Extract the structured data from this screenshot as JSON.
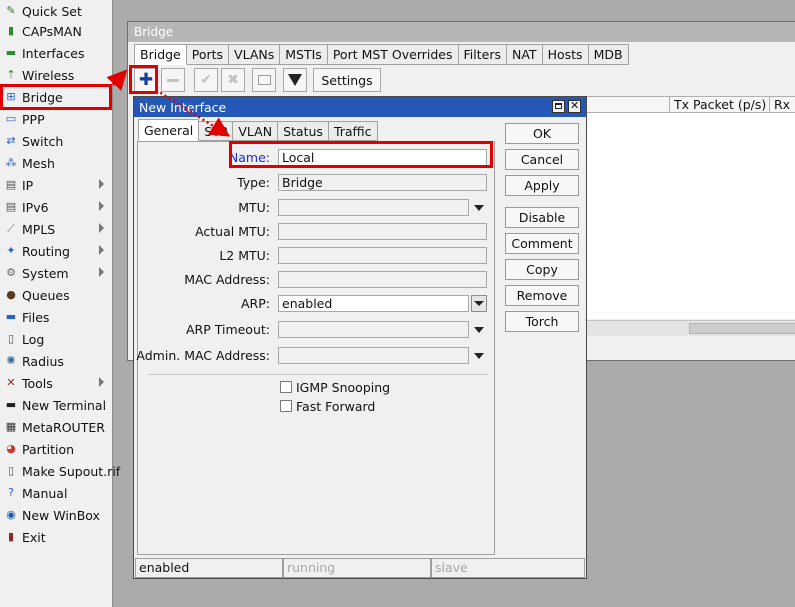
{
  "sidebar": {
    "items": [
      {
        "label": "Quick Set",
        "icon": "quick-set-icon",
        "glyph": "✎",
        "color": "#3b6f2b"
      },
      {
        "label": "CAPsMAN",
        "icon": "capsman-icon",
        "glyph": "▮",
        "color": "#2f8a2f"
      },
      {
        "label": "Interfaces",
        "icon": "interfaces-icon",
        "glyph": "▬",
        "color": "#2f8a2f"
      },
      {
        "label": "Wireless",
        "icon": "wireless-icon",
        "glyph": "⇡",
        "color": "#2f8a2f"
      },
      {
        "label": "Bridge",
        "icon": "bridge-icon",
        "glyph": "⊞",
        "color": "#2a62c8"
      },
      {
        "label": "PPP",
        "icon": "ppp-icon",
        "glyph": "▭",
        "color": "#2a62c8"
      },
      {
        "label": "Switch",
        "icon": "switch-icon",
        "glyph": "⇄",
        "color": "#2a62c8"
      },
      {
        "label": "Mesh",
        "icon": "mesh-icon",
        "glyph": "⁂",
        "color": "#2a62c8"
      },
      {
        "label": "IP",
        "icon": "ip-icon",
        "glyph": "▤",
        "color": "#555555",
        "submenu": true
      },
      {
        "label": "IPv6",
        "icon": "ipv6-icon",
        "glyph": "▤",
        "color": "#555555",
        "submenu": true
      },
      {
        "label": "MPLS",
        "icon": "mpls-icon",
        "glyph": "⟋",
        "color": "#777777",
        "submenu": true
      },
      {
        "label": "Routing",
        "icon": "routing-icon",
        "glyph": "✦",
        "color": "#2a62c8",
        "submenu": true
      },
      {
        "label": "System",
        "icon": "system-icon",
        "glyph": "⚙",
        "color": "#666666",
        "submenu": true
      },
      {
        "label": "Queues",
        "icon": "queues-icon",
        "glyph": "●",
        "color": "#5a3a1a"
      },
      {
        "label": "Files",
        "icon": "files-icon",
        "glyph": "▬",
        "color": "#2a62c8"
      },
      {
        "label": "Log",
        "icon": "log-icon",
        "glyph": "▯",
        "color": "#555555"
      },
      {
        "label": "Radius",
        "icon": "radius-icon",
        "glyph": "✺",
        "color": "#3a6a9a"
      },
      {
        "label": "Tools",
        "icon": "tools-icon",
        "glyph": "✕",
        "color": "#8a2a2a",
        "submenu": true
      },
      {
        "label": "New Terminal",
        "icon": "terminal-icon",
        "glyph": "▬",
        "color": "#222222"
      },
      {
        "label": "MetaROUTER",
        "icon": "metarouter-icon",
        "glyph": "▦",
        "color": "#333333"
      },
      {
        "label": "Partition",
        "icon": "partition-icon",
        "glyph": "◕",
        "color": "#c83a2a"
      },
      {
        "label": "Make Supout.rif",
        "icon": "supout-icon",
        "glyph": "▯",
        "color": "#555555"
      },
      {
        "label": "Manual",
        "icon": "manual-icon",
        "glyph": "?",
        "color": "#2a62c8"
      },
      {
        "label": "New WinBox",
        "icon": "winbox-icon",
        "glyph": "◉",
        "color": "#1a5aa8"
      },
      {
        "label": "Exit",
        "icon": "exit-icon",
        "glyph": "▮",
        "color": "#8a2a2a"
      }
    ]
  },
  "bridge_window": {
    "title": "Bridge",
    "tabs": [
      "Bridge",
      "Ports",
      "VLANs",
      "MSTIs",
      "Port MST Overrides",
      "Filters",
      "NAT",
      "Hosts",
      "MDB"
    ],
    "toolbar": {
      "settings_label": "Settings"
    },
    "columns": [
      "Tx Packet (p/s)",
      "Rx P"
    ]
  },
  "dialog": {
    "title": "New Interface",
    "tabs": [
      "General",
      "STP",
      "VLAN",
      "Status",
      "Traffic"
    ],
    "fields": {
      "name": {
        "label": "Name:",
        "value": "Local"
      },
      "type": {
        "label": "Type:",
        "value": "Bridge"
      },
      "mtu": {
        "label": "MTU:",
        "value": ""
      },
      "actual_mtu": {
        "label": "Actual MTU:",
        "value": ""
      },
      "l2_mtu": {
        "label": "L2 MTU:",
        "value": ""
      },
      "mac_address": {
        "label": "MAC Address:",
        "value": ""
      },
      "arp": {
        "label": "ARP:",
        "value": "enabled"
      },
      "arp_timeout": {
        "label": "ARP Timeout:",
        "value": ""
      },
      "admin_mac": {
        "label": "Admin. MAC Address:",
        "value": ""
      }
    },
    "checkboxes": {
      "igmp_snooping": {
        "label": "IGMP Snooping",
        "checked": false
      },
      "fast_forward": {
        "label": "Fast Forward",
        "checked": false
      }
    },
    "buttons": {
      "ok": "OK",
      "cancel": "Cancel",
      "apply": "Apply",
      "disable": "Disable",
      "comment": "Comment",
      "copy": "Copy",
      "remove": "Remove",
      "torch": "Torch"
    },
    "status": [
      "enabled",
      "running",
      "slave"
    ]
  },
  "colors": {
    "highlight": "#e00000",
    "dialog_title": "#2457b6",
    "name_label": "#1a2fd0",
    "plus_icon": "#1a3f9e",
    "filter_icon": "#222222"
  }
}
